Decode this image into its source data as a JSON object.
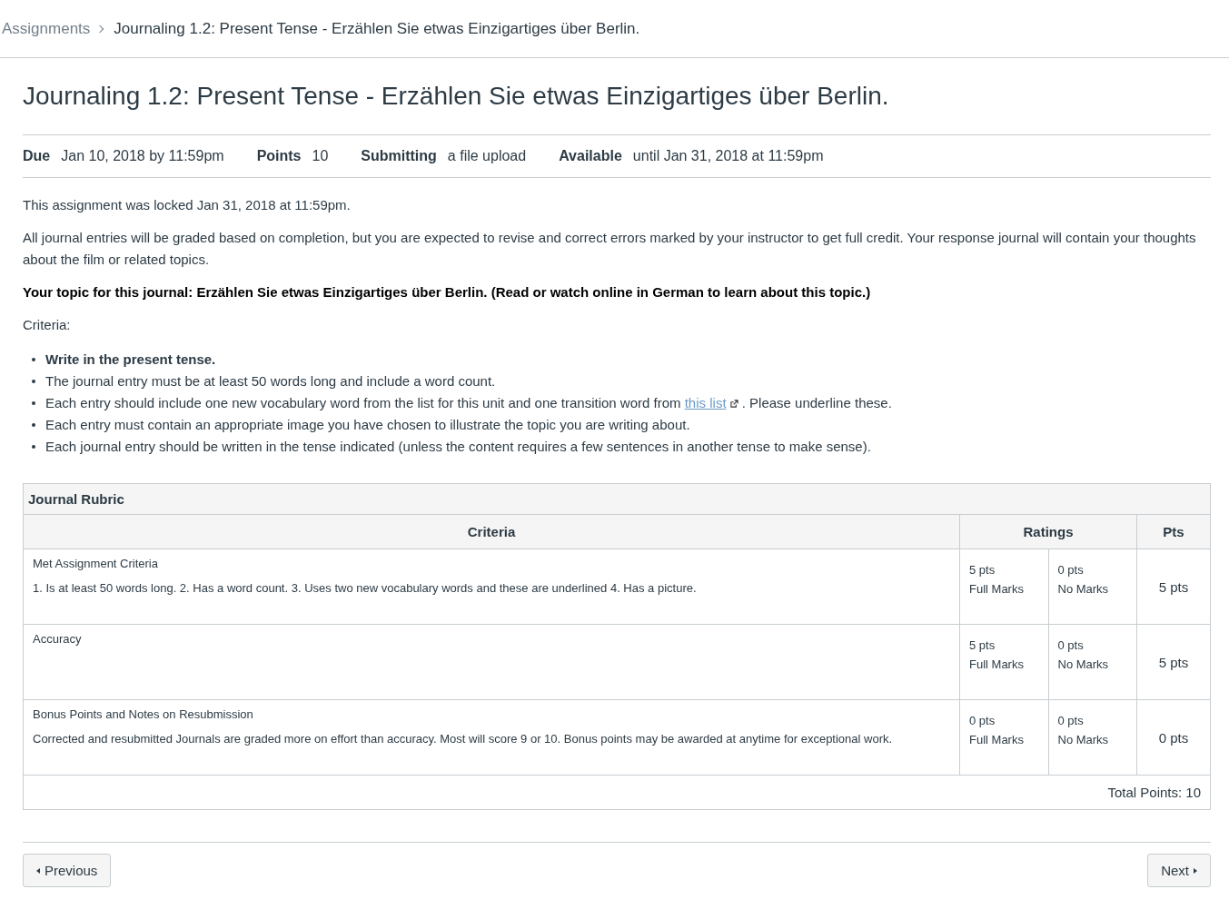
{
  "breadcrumbs": [
    {
      "label": "Assignments"
    },
    {
      "label": "Journaling 1.2: Present Tense - Erzählen Sie etwas Einzigartiges über Berlin."
    }
  ],
  "title": "Journaling 1.2: Present Tense - Erzählen Sie etwas Einzigartiges über Berlin.",
  "details": [
    {
      "label": "Due",
      "value": "Jan 10, 2018 by 11:59pm"
    },
    {
      "label": "Points",
      "value": "10"
    },
    {
      "label": "Submitting",
      "value": "a file upload"
    },
    {
      "label": "Available",
      "value": "until Jan 31, 2018 at 11:59pm"
    }
  ],
  "paragraphs": [
    {
      "text": "This assignment was locked Jan 31, 2018 at 11:59pm.",
      "bold": false
    },
    {
      "text": "All journal entries will be graded based on completion, but you are expected to revise and correct errors marked by your instructor to get full credit. Your response journal will contain your thoughts about the film or related topics.",
      "bold": false
    },
    {
      "text": "Your topic for this journal: Erzählen Sie etwas Einzigartiges über Berlin. (Read or watch online in German to learn about this topic.)",
      "bold": true
    },
    {
      "text": "Criteria:",
      "bold": false
    }
  ],
  "criteria_list": [
    {
      "text": "Write in the present tense.",
      "bold": true
    },
    {
      "text": "The journal entry must be at least 50 words long and include a word count.",
      "bold": false
    },
    {
      "text": "Each entry should include one new vocabulary word from the list for this unit and one transition word from",
      "link": "this list",
      "after": ". Please underline these.",
      "bold": false
    },
    {
      "text": "Each entry must contain an appropriate image you have chosen to illustrate the topic you are writing about.",
      "bold": false
    },
    {
      "text": "Each journal entry should be written in the tense indicated (unless the content requires a few sentences in another tense to make sense).",
      "bold": false
    }
  ],
  "rubric": {
    "title": "Journal Rubric",
    "columns": [
      "Criteria",
      "Ratings",
      "Pts"
    ],
    "rows": [
      {
        "criterion": "Met Assignment Criteria",
        "description": "1. Is at least 50 words long. 2. Has a word count. 3. Uses two new vocabulary words and these are underlined 4. Has a picture.",
        "ratings": [
          {
            "points": "5 pts",
            "label": "Full Marks"
          },
          {
            "points": "0 pts",
            "label": "No Marks"
          }
        ],
        "pts": "5 pts"
      },
      {
        "criterion": "Accuracy",
        "ratings": [
          {
            "points": "5 pts",
            "label": "Full Marks"
          },
          {
            "points": "0 pts",
            "label": "No Marks"
          }
        ],
        "pts": "5 pts"
      },
      {
        "criterion": "Bonus Points and Notes on Resubmission",
        "description": "Corrected and resubmitted Journals are graded more on effort than accuracy. Most will score 9 or 10. Bonus points may be awarded at anytime for exceptional work.",
        "ratings": [
          {
            "points": "0 pts",
            "label": "Full Marks"
          },
          {
            "points": "0 pts",
            "label": "No Marks"
          }
        ],
        "pts": "0 pts"
      }
    ],
    "total": "Total Points: 10"
  },
  "nav": {
    "previous": "Previous",
    "next": "Next"
  }
}
